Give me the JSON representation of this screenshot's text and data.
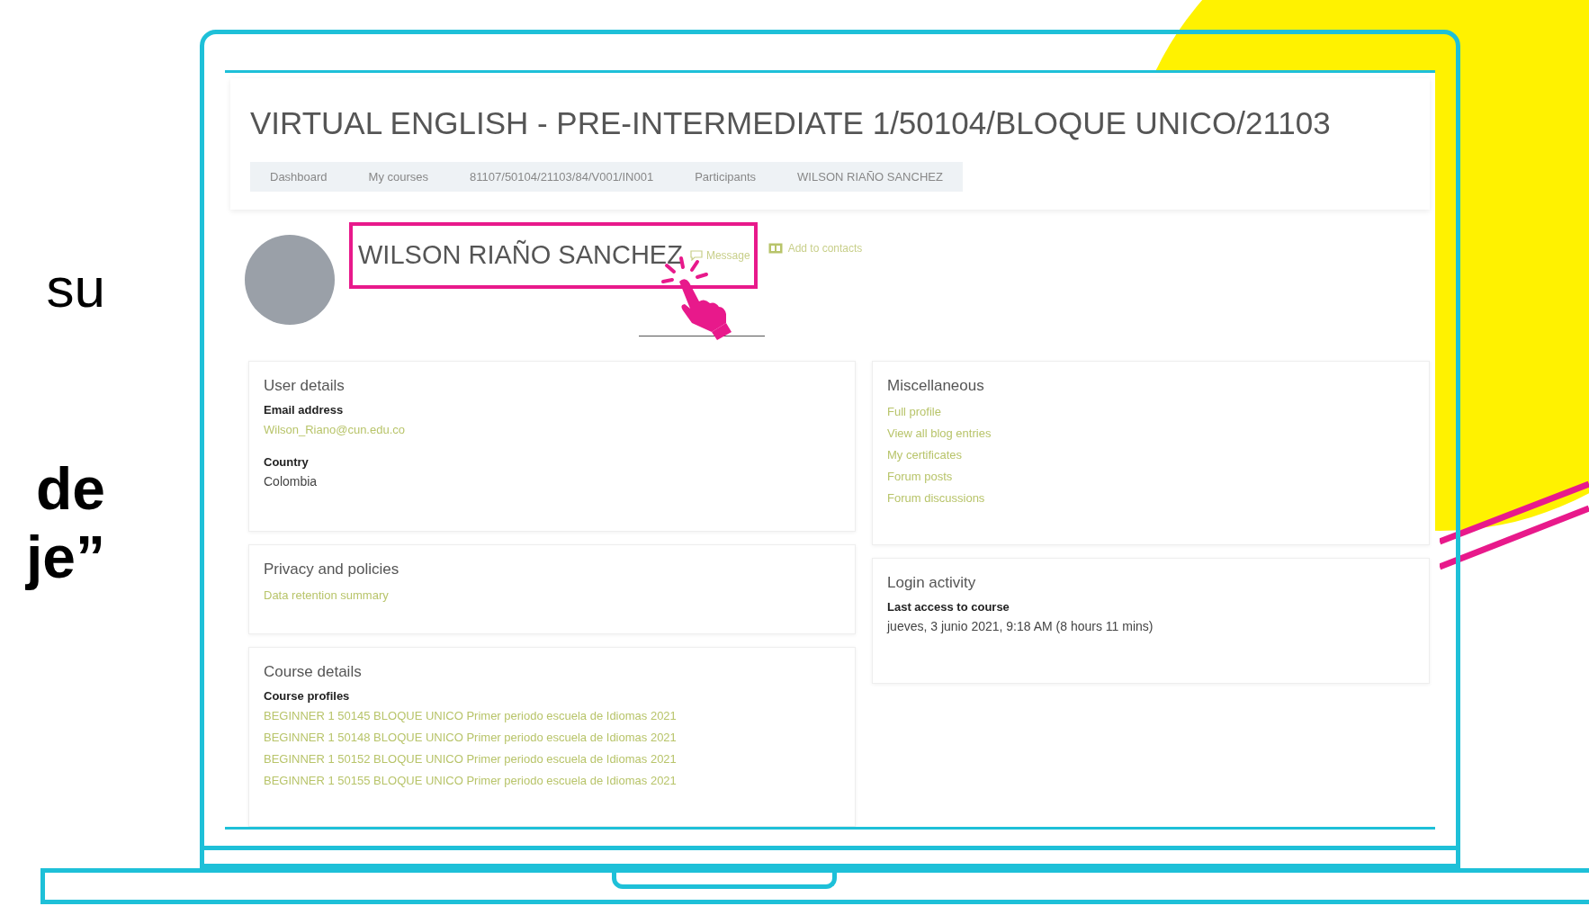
{
  "slide_text": [
    {
      "text": "su",
      "bold": false
    },
    {
      "text": "de",
      "bold": true
    },
    {
      "text": "je”",
      "bold": true
    }
  ],
  "page": {
    "title": "VIRTUAL ENGLISH - PRE-INTERMEDIATE 1/50104/BLOQUE UNICO/21103",
    "breadcrumb": [
      "Dashboard",
      "My courses",
      "81107/50104/21103/84/V001/IN001",
      "Participants",
      "WILSON RIAÑO SANCHEZ"
    ],
    "profile": {
      "name": "WILSON RIAÑO SANCHEZ",
      "highlighted": true,
      "message": "Message",
      "add_contacts": "Add to contacts"
    },
    "left_cards": [
      {
        "title": "User details",
        "items": [
          {
            "kind": "label",
            "text": "Email address"
          },
          {
            "kind": "link",
            "text": "Wilson_Riano@cun.edu.co"
          },
          {
            "kind": "gap"
          },
          {
            "kind": "label",
            "text": "Country"
          },
          {
            "kind": "value",
            "text": "Colombia"
          }
        ]
      },
      {
        "title": "Privacy and policies",
        "items": [
          {
            "kind": "link",
            "text": "Data retention summary"
          }
        ]
      },
      {
        "title": "Course details",
        "items": [
          {
            "kind": "label",
            "text": "Course profiles"
          },
          {
            "kind": "link",
            "text": "BEGINNER 1 50145 BLOQUE UNICO Primer periodo escuela de Idiomas 2021"
          },
          {
            "kind": "link",
            "text": "BEGINNER 1 50148 BLOQUE UNICO Primer periodo escuela de Idiomas 2021"
          },
          {
            "kind": "link",
            "text": "BEGINNER 1 50152 BLOQUE UNICO Primer periodo escuela de Idiomas 2021"
          },
          {
            "kind": "link",
            "text": "BEGINNER 1 50155 BLOQUE UNICO Primer periodo escuela de Idiomas 2021"
          }
        ]
      }
    ],
    "right_cards": [
      {
        "title": "Miscellaneous",
        "items": [
          {
            "kind": "link",
            "text": "Full profile"
          },
          {
            "kind": "link",
            "text": "View all blog entries"
          },
          {
            "kind": "link",
            "text": "My certificates"
          },
          {
            "kind": "link",
            "text": "Forum posts"
          },
          {
            "kind": "link",
            "text": "Forum discussions"
          }
        ]
      },
      {
        "title": "Login activity",
        "items": [
          {
            "kind": "label",
            "text": "Last access to course"
          },
          {
            "kind": "value",
            "text": "jueves, 3 junio 2021, 9:18 AM  (8 hours 11 mins)"
          }
        ]
      }
    ]
  }
}
